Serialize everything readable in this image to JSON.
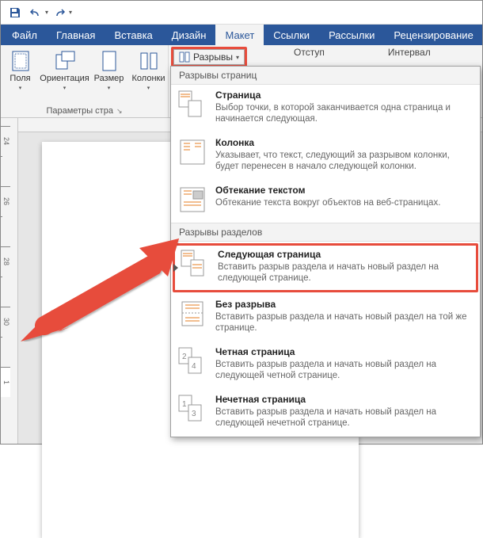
{
  "qat": {
    "save": "save-icon",
    "undo": "undo-icon",
    "redo": "redo-icon"
  },
  "tabs": [
    {
      "label": "Файл"
    },
    {
      "label": "Главная"
    },
    {
      "label": "Вставка"
    },
    {
      "label": "Дизайн"
    },
    {
      "label": "Макет",
      "active": true
    },
    {
      "label": "Ссылки"
    },
    {
      "label": "Рассылки"
    },
    {
      "label": "Рецензирование"
    }
  ],
  "ribbon": {
    "buttons": [
      {
        "label": "Поля"
      },
      {
        "label": "Ориентация"
      },
      {
        "label": "Размер"
      },
      {
        "label": "Колонки"
      }
    ],
    "group_title": "Параметры стра",
    "breaks_label": "Разрывы",
    "indent_label": "Отступ",
    "spacing_label": "Интервал"
  },
  "dropdown": {
    "section1": "Разрывы страниц",
    "items1": [
      {
        "title": "Страница",
        "desc": "Выбор точки, в которой заканчивается одна страница и начинается следующая."
      },
      {
        "title": "Колонка",
        "desc": "Указывает, что текст, следующий за разрывом колонки, будет перенесен в начало следующей колонки."
      },
      {
        "title": "Обтекание текстом",
        "desc": "Обтекание текста вокруг объектов на веб-страницах."
      }
    ],
    "section2": "Разрывы разделов",
    "items2": [
      {
        "title": "Следующая страница",
        "desc": "Вставить разрыв раздела и начать новый раздел на следующей странице.",
        "highlighted": true
      },
      {
        "title": "Без разрыва",
        "desc": "Вставить разрыв раздела и начать новый раздел на той же странице."
      },
      {
        "title": "Четная страница",
        "desc": "Вставить разрыв раздела и начать новый раздел на следующей четной странице."
      },
      {
        "title": "Нечетная страница",
        "desc": "Вставить разрыв раздела и начать новый раздел на следующей нечетной странице."
      }
    ]
  },
  "ruler_marks": [
    "24",
    "",
    "26",
    "",
    "28",
    "",
    "30",
    "",
    "1"
  ],
  "ruler_corner": "L"
}
